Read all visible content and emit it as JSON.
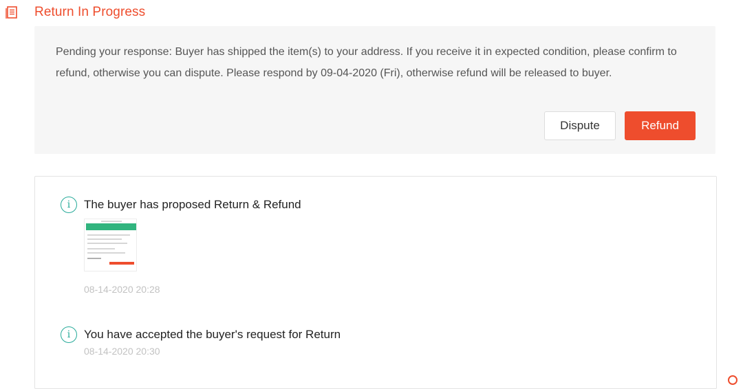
{
  "header": {
    "title": "Return In Progress",
    "icon": "document-list-icon",
    "accent_color": "#ee4d2d"
  },
  "notice": {
    "text": "Pending your response: Buyer has shipped the item(s) to your address. If you receive it in expected condition, please confirm to refund, otherwise you can dispute. Please respond by 09-04-2020 (Fri), otherwise refund will be released to buyer.",
    "dispute_label": "Dispute",
    "refund_label": "Refund"
  },
  "history": {
    "events": [
      {
        "title": "The buyer has proposed Return & Refund",
        "time": "08-14-2020 20:28",
        "icon": "info-icon",
        "has_attachment": true
      },
      {
        "title": "You have accepted the buyer's request for Return",
        "time": "08-14-2020 20:30",
        "icon": "info-icon",
        "has_attachment": false
      }
    ],
    "icon_color": "#26aa99"
  }
}
